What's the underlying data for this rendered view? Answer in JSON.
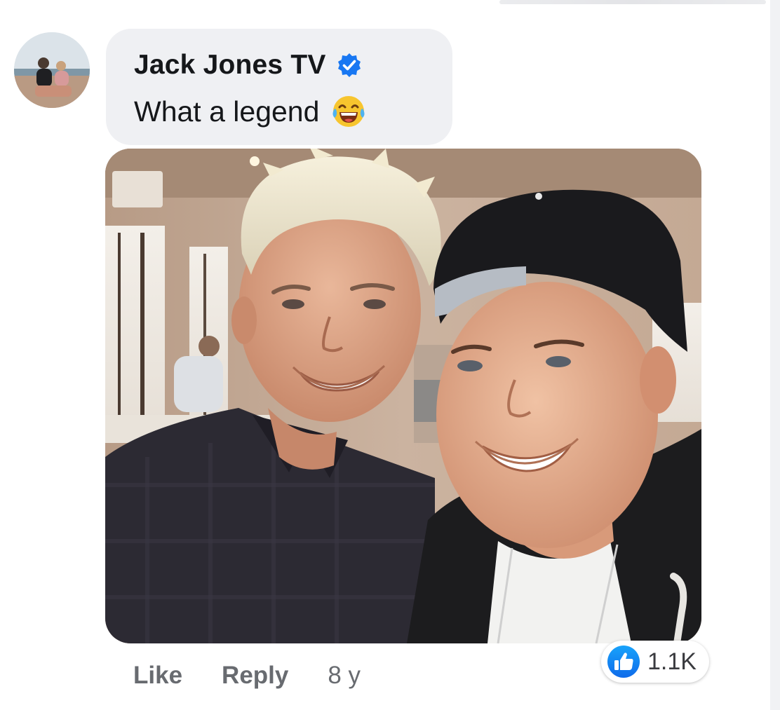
{
  "comment": {
    "author": "Jack Jones TV",
    "verified": true,
    "text": "What a legend",
    "emoji": "laughing-tears-emoji",
    "avatar": "profile-photo",
    "attached_photo": "selfie-photo"
  },
  "actions": {
    "like_label": "Like",
    "reply_label": "Reply",
    "timestamp": "8 y"
  },
  "reactions": {
    "icon": "thumbs-up-icon",
    "count": "1.1K"
  },
  "colors": {
    "bubble": "#eff0f3",
    "verified_blue": "#1877f2",
    "action_text": "#686b70",
    "like_blue": "#1877f2"
  }
}
